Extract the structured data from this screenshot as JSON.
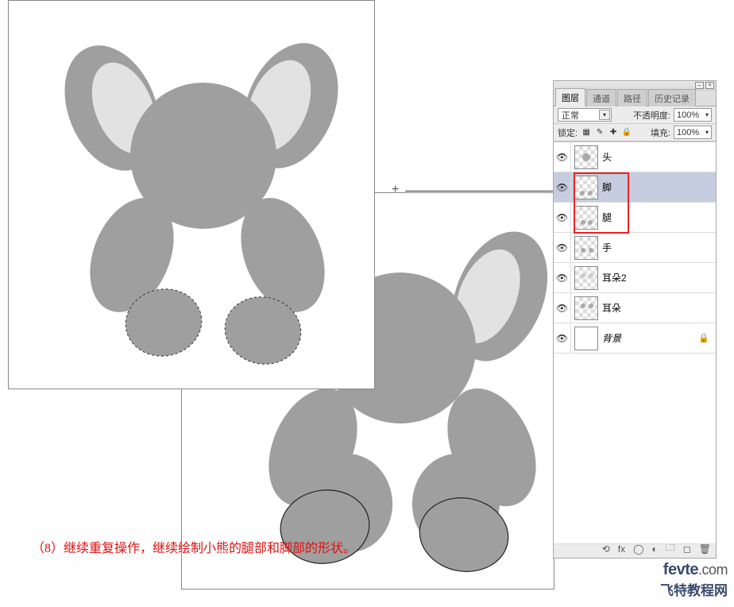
{
  "caption": "（8）继续重复操作，继续绘制小熊的腿部和脚部的形状。",
  "watermark": {
    "site": "fevte",
    "ext": ".com",
    "cn": "飞特教程网"
  },
  "panel": {
    "tabs": [
      "图层",
      "通道",
      "路径",
      "历史记录"
    ],
    "active_tab": 0,
    "blend_label": "正常",
    "opacity_label": "不透明度:",
    "opacity_value": "100%",
    "lock_label": "锁定:",
    "fill_label": "填充:",
    "fill_value": "100%",
    "layers": [
      {
        "name": "头",
        "visible": true
      },
      {
        "name": "脚",
        "visible": true,
        "selected": true
      },
      {
        "name": "腿",
        "visible": true
      },
      {
        "name": "手",
        "visible": true
      },
      {
        "name": "耳朵2",
        "visible": true
      },
      {
        "name": "耳朵",
        "visible": true
      },
      {
        "name": "背景",
        "visible": true,
        "locked": true,
        "italic": true,
        "solid": true
      }
    ]
  },
  "icons": {
    "minimize": "–",
    "close": "×",
    "dropdown": "▾",
    "eye": "👁",
    "lock": "🔒",
    "link": "⟲",
    "fx": "fx",
    "mask": "◯",
    "folder": "🗀",
    "new": "◻",
    "trash": "🗑",
    "brush": "✎",
    "checker": "▦",
    "plus": "✚"
  },
  "shapes": {
    "body_gray": "#9f9f9f",
    "inner_ear": "#e2e2e2",
    "dark_gray": "#8a8a8a"
  }
}
